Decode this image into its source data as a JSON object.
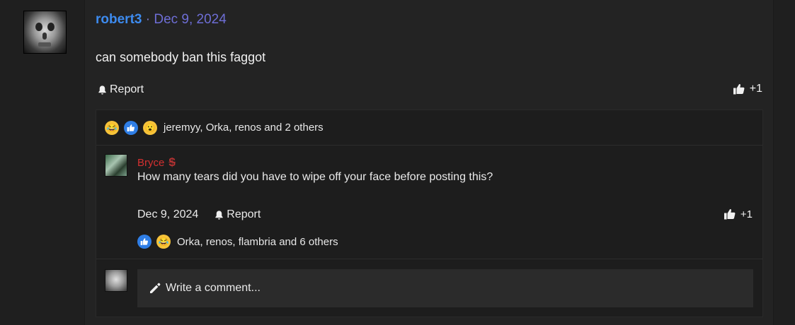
{
  "post": {
    "username": "robert3",
    "separator": "·",
    "date": "Dec 9, 2024",
    "body": "can somebody ban this faggot",
    "report_label": "Report",
    "like_count": "+1",
    "reactions_text": "jeremyy, Orka, renos and 2 others",
    "reaction_icons": [
      "laugh-emoji",
      "like-emoji",
      "wow-emoji"
    ]
  },
  "comment": {
    "username": "Bryce",
    "badge_icon": "dollar-icon",
    "text": "How many tears did you have to wipe off your face before posting this?",
    "date": "Dec 9, 2024",
    "report_label": "Report",
    "like_count": "+1",
    "reactions_text": "Orka, renos, flambria and 6 others",
    "reaction_icons": [
      "like-emoji",
      "laugh-emoji"
    ]
  },
  "composer": {
    "placeholder": "Write a comment..."
  },
  "colors": {
    "background": "#232323",
    "username": "#3d8bef",
    "date": "#6e6ed6",
    "comment_username": "#d33030"
  }
}
